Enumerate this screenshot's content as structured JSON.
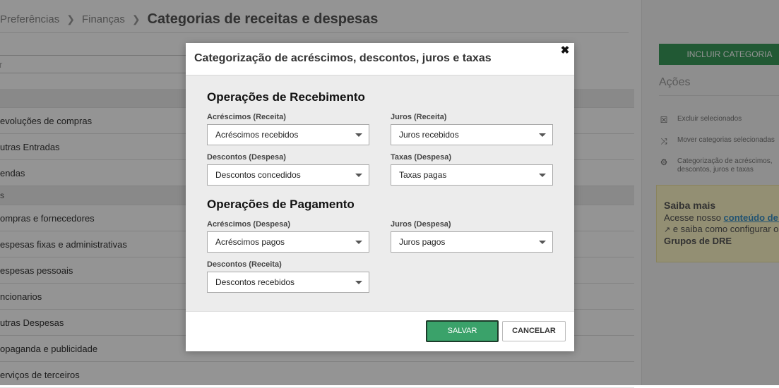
{
  "breadcrumb": {
    "items": [
      "Preferências",
      "Finanças"
    ],
    "current": "Categorias de receitas e despesas"
  },
  "filter": {
    "placeholder": "r"
  },
  "list": {
    "row1": "evoluções de compras",
    "row2": "utras Entradas",
    "row3": "endas",
    "group2": "s",
    "row4": "ompras e fornecedores",
    "row5": "espesas fixas e administrativas",
    "row6": "espesas pessoais",
    "row7": "ncionarios",
    "row8": "utras Despesas",
    "row9": "opaganda e publicidade",
    "row10": "erviços de terceiros"
  },
  "sidebar": {
    "include_button": "INCLUIR CATEGORIA",
    "actions_title": "Ações",
    "actions": [
      {
        "label": "Excluir selecionados",
        "icon": "delete-icon"
      },
      {
        "label": "Mover categorias selecionadas",
        "icon": "shuffle-icon"
      },
      {
        "label": "Categorização de acréscimos, descontos, juros e taxas",
        "icon": "gear-icon"
      }
    ],
    "help": {
      "title": "Saiba mais",
      "text_before": "Acesse nosso ",
      "link": "conteúdo de ajuda",
      "text_after": " e saiba como configurar os ",
      "bold": "Grupos de DRE"
    }
  },
  "modal": {
    "title": "Categorização de acréscimos, descontos, juros e taxas",
    "recebimento": {
      "title": "Operações de Recebimento",
      "acrescimos": {
        "label": "Acréscimos (Receita)",
        "value": "Acréscimos recebidos"
      },
      "juros": {
        "label": "Juros (Receita)",
        "value": "Juros recebidos"
      },
      "descontos": {
        "label": "Descontos (Despesa)",
        "value": "Descontos concedidos"
      },
      "taxas": {
        "label": "Taxas (Despesa)",
        "value": "Taxas pagas"
      }
    },
    "pagamento": {
      "title": "Operações de Pagamento",
      "acrescimos": {
        "label": "Acréscimos (Despesa)",
        "value": "Acréscimos pagos"
      },
      "juros": {
        "label": "Juros (Despesa)",
        "value": "Juros pagos"
      },
      "descontos": {
        "label": "Descontos (Receita)",
        "value": "Descontos recebidos"
      }
    },
    "save_label": "SALVAR",
    "cancel_label": "CANCELAR"
  }
}
